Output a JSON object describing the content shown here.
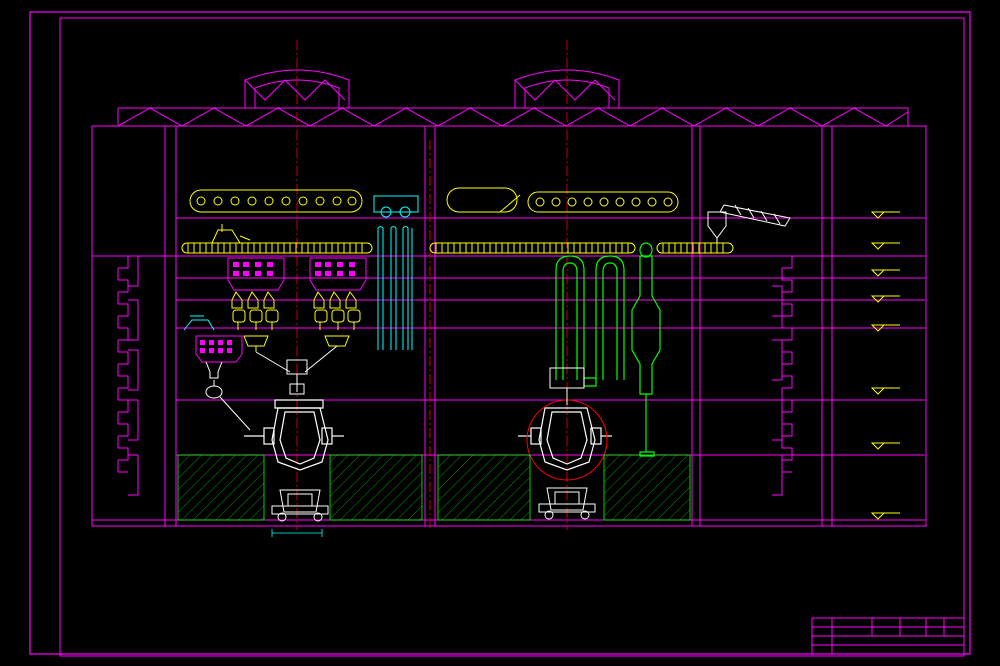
{
  "colors": {
    "background": "#000000",
    "frame": "#ff00ff",
    "building": "#ff00ff",
    "equipment": "#ffff00",
    "ladle": "#ffffff",
    "piping": "#00ff00",
    "crane": "#00ffff",
    "axis": "#ff0000",
    "text": "#ffff00",
    "hatch": "#00ff00"
  },
  "level_marks": [
    "",
    "",
    " ",
    " ",
    " ",
    " ",
    " ",
    ""
  ],
  "title_block": {
    "project": "",
    "sheet": "",
    "rows": [
      "",
      ""
    ],
    "labels": [
      "",
      "",
      "",
      ""
    ]
  }
}
